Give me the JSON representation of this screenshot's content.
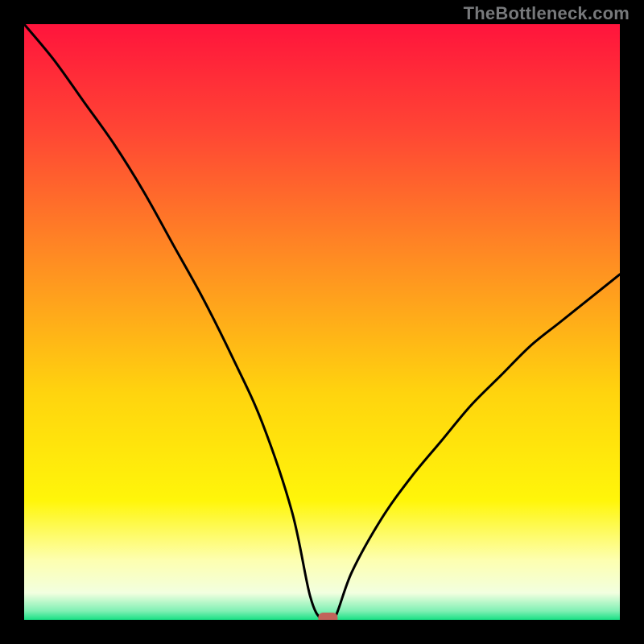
{
  "watermark": "TheBottleneck.com",
  "chart_data": {
    "type": "line",
    "title": "",
    "xlabel": "",
    "ylabel": "",
    "xlim": [
      0,
      100
    ],
    "ylim": [
      0,
      100
    ],
    "series": [
      {
        "name": "bottleneck-curve",
        "x": [
          0,
          5,
          10,
          15,
          20,
          25,
          30,
          35,
          40,
          45,
          48,
          50,
          52,
          55,
          60,
          65,
          70,
          75,
          80,
          85,
          90,
          95,
          100
        ],
        "y": [
          100,
          94,
          87,
          80,
          72,
          63,
          54,
          44,
          33,
          18,
          4,
          0,
          0,
          8,
          17,
          24,
          30,
          36,
          41,
          46,
          50,
          54,
          58
        ]
      }
    ],
    "marker": {
      "x": 51,
      "y": 0,
      "label": "optimal-point"
    },
    "gradient_stops": [
      {
        "offset": 0.0,
        "color": "#ff143c"
      },
      {
        "offset": 0.18,
        "color": "#ff4634"
      },
      {
        "offset": 0.4,
        "color": "#ff8e22"
      },
      {
        "offset": 0.62,
        "color": "#ffd40e"
      },
      {
        "offset": 0.8,
        "color": "#fff60a"
      },
      {
        "offset": 0.9,
        "color": "#fdffb0"
      },
      {
        "offset": 0.955,
        "color": "#f2ffe0"
      },
      {
        "offset": 0.985,
        "color": "#80f0b4"
      },
      {
        "offset": 1.0,
        "color": "#18e084"
      }
    ]
  }
}
